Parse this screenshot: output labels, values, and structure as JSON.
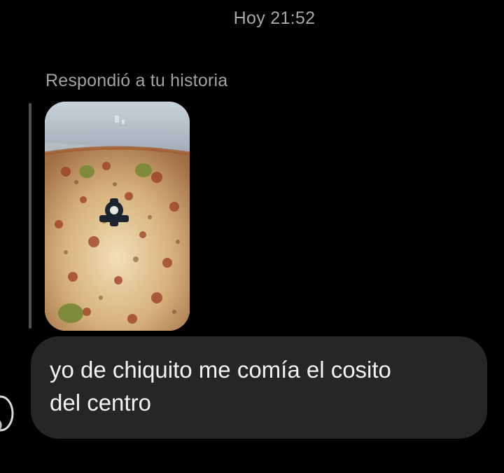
{
  "conversation": {
    "timestamp": "Hoy 21:52",
    "reply_label": "Respondió a tu historia",
    "message_text": "yo de chiquito me comía el cosito\ndel centro"
  },
  "colors": {
    "background": "#000000",
    "bubble": "#262626",
    "muted_text": "#a8a8a8",
    "story_bar": "#4f4f4f"
  },
  "icons": {
    "avatar": "profile-avatar-icon"
  }
}
